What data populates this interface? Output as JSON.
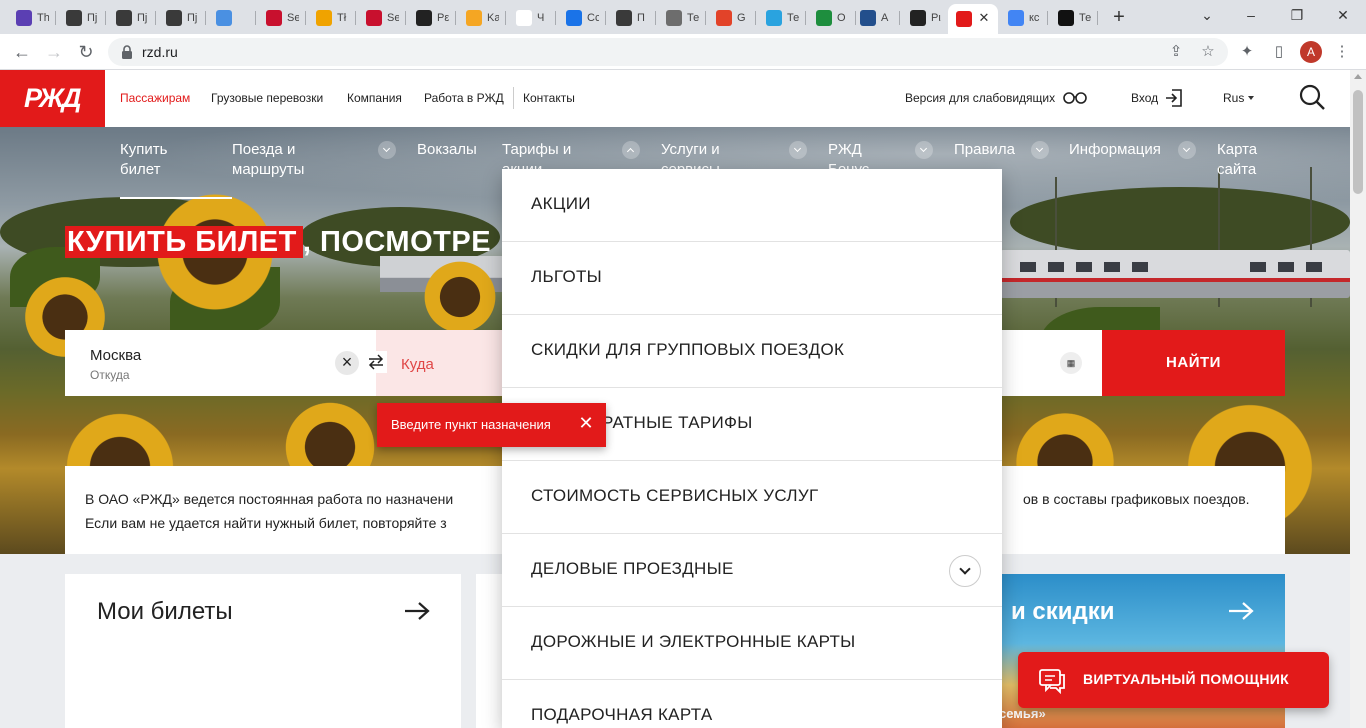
{
  "browser": {
    "tabs": [
      {
        "label": "Th",
        "color": "#5b3fb3",
        "icon": "form-icon"
      },
      {
        "label": "Пј",
        "color": "#3a3a3a",
        "icon": "openai-icon"
      },
      {
        "label": "Пј",
        "color": "#3a3a3a",
        "icon": "openai-icon"
      },
      {
        "label": "Пј",
        "color": "#3a3a3a",
        "icon": "openai-icon"
      },
      {
        "label": "",
        "color": "#4a90e2",
        "icon": "sparkle-icon"
      },
      {
        "label": "Se",
        "color": "#c8102e",
        "icon": "bookmark-icon"
      },
      {
        "label": "Tł",
        "color": "#f0a300",
        "icon": "c-icon"
      },
      {
        "label": "Se",
        "color": "#c8102e",
        "icon": "bookmark-icon"
      },
      {
        "label": "Pε",
        "color": "#222222",
        "icon": "rb-icon"
      },
      {
        "label": "Ka",
        "color": "#f5a623",
        "icon": "coin-icon"
      },
      {
        "label": "Ч",
        "color": "#ffffff",
        "icon": "h-icon"
      },
      {
        "label": "Сс",
        "color": "#1a73e8",
        "icon": "circle-icon"
      },
      {
        "label": "П",
        "color": "#3a3a3a",
        "icon": "openai-icon"
      },
      {
        "label": "Те",
        "color": "#6d6d6d",
        "icon": "photo-icon"
      },
      {
        "label": "G",
        "color": "#e24329",
        "icon": "git-icon"
      },
      {
        "label": "Те",
        "color": "#2aa3df",
        "icon": "telegram-icon"
      },
      {
        "label": "О",
        "color": "#1e8e3e",
        "icon": "plus-icon"
      },
      {
        "label": "А",
        "color": "#234f8c",
        "icon": "sheet-icon"
      },
      {
        "label": "Рι",
        "color": "#222222",
        "icon": "yt-icon"
      },
      {
        "label": "",
        "color": "#e21a1a",
        "icon": "rzd-icon",
        "active": true
      },
      {
        "label": "кс",
        "color": "#4285f4",
        "icon": "google-icon"
      },
      {
        "label": "Те",
        "color": "#111111",
        "icon": "film-icon"
      }
    ],
    "url": "rzd.ru",
    "profile_initial": "A"
  },
  "header": {
    "logo_text": "РЖД",
    "nav": [
      "Пассажирам",
      "Грузовые перевозки",
      "Компания",
      "Работа в РЖД",
      "Контакты"
    ],
    "accessibility": "Версия для слабовидящих",
    "login": "Вход",
    "language": "Rus"
  },
  "hero_nav": [
    {
      "line1": "Купить",
      "line2": "билет"
    },
    {
      "line1": "Поезда и",
      "line2": "маршруты"
    },
    {
      "line1": "Вокзалы",
      "line2": ""
    },
    {
      "line1": "Тарифы и",
      "line2": "акции"
    },
    {
      "line1": "Услуги и",
      "line2": "сервисы"
    },
    {
      "line1": "РЖД",
      "line2": "Бонус"
    },
    {
      "line1": "Правила",
      "line2": ""
    },
    {
      "line1": "Информация",
      "line2": ""
    },
    {
      "line1": "Карта",
      "line2": "сайта"
    }
  ],
  "headline": {
    "highlight": "КУПИТЬ БИЛЕТ",
    "rest": ", ПОСМОТРЕ"
  },
  "search": {
    "from_value": "Москва",
    "from_label": "Откуда",
    "to_placeholder": "Куда",
    "find_label": "НАЙТИ",
    "calendar_icon": "calendar-icon"
  },
  "tooltip": {
    "text": "Введите пункт назначения"
  },
  "notice": {
    "line1_left": "В ОАО «РЖД» ведется постоянная работа по назначени",
    "line1_right": "ов в составы графиковых поездов.",
    "line2": "Если вам не удается найти нужный билет, повторяйте з"
  },
  "dropdown": [
    {
      "label": "АКЦИИ",
      "expandable": false
    },
    {
      "label": "ЛЬГОТЫ",
      "expandable": false
    },
    {
      "label": "СКИДКИ ДЛЯ ГРУППОВЫХ ПОЕЗДОК",
      "expandable": false
    },
    {
      "label": "РАТНЫЕ ТАРИФЫ",
      "expandable": false
    },
    {
      "label": "СТОИМОСТЬ СЕРВИСНЫХ УСЛУГ",
      "expandable": false
    },
    {
      "label": "ДЕЛОВЫЕ ПРОЕЗДНЫЕ",
      "expandable": true
    },
    {
      "label": "ДОРОЖНЫЕ И ЭЛЕКТРОННЫЕ КАРТЫ",
      "expandable": false
    },
    {
      "label": "ПОДАРОЧНАЯ КАРТА",
      "expandable": false
    }
  ],
  "cards": {
    "tickets_title": "Мои билеты",
    "promo_title": "и скидки",
    "promo_sub": "семья»"
  },
  "assistant": {
    "label": "ВИРТУАЛЬНЫЙ ПОМОЩНИК"
  },
  "colors": {
    "brand": "#e21a1a",
    "text": "#222222",
    "notice_bg": "#ffffff",
    "lower_bg": "#ebedf0"
  }
}
